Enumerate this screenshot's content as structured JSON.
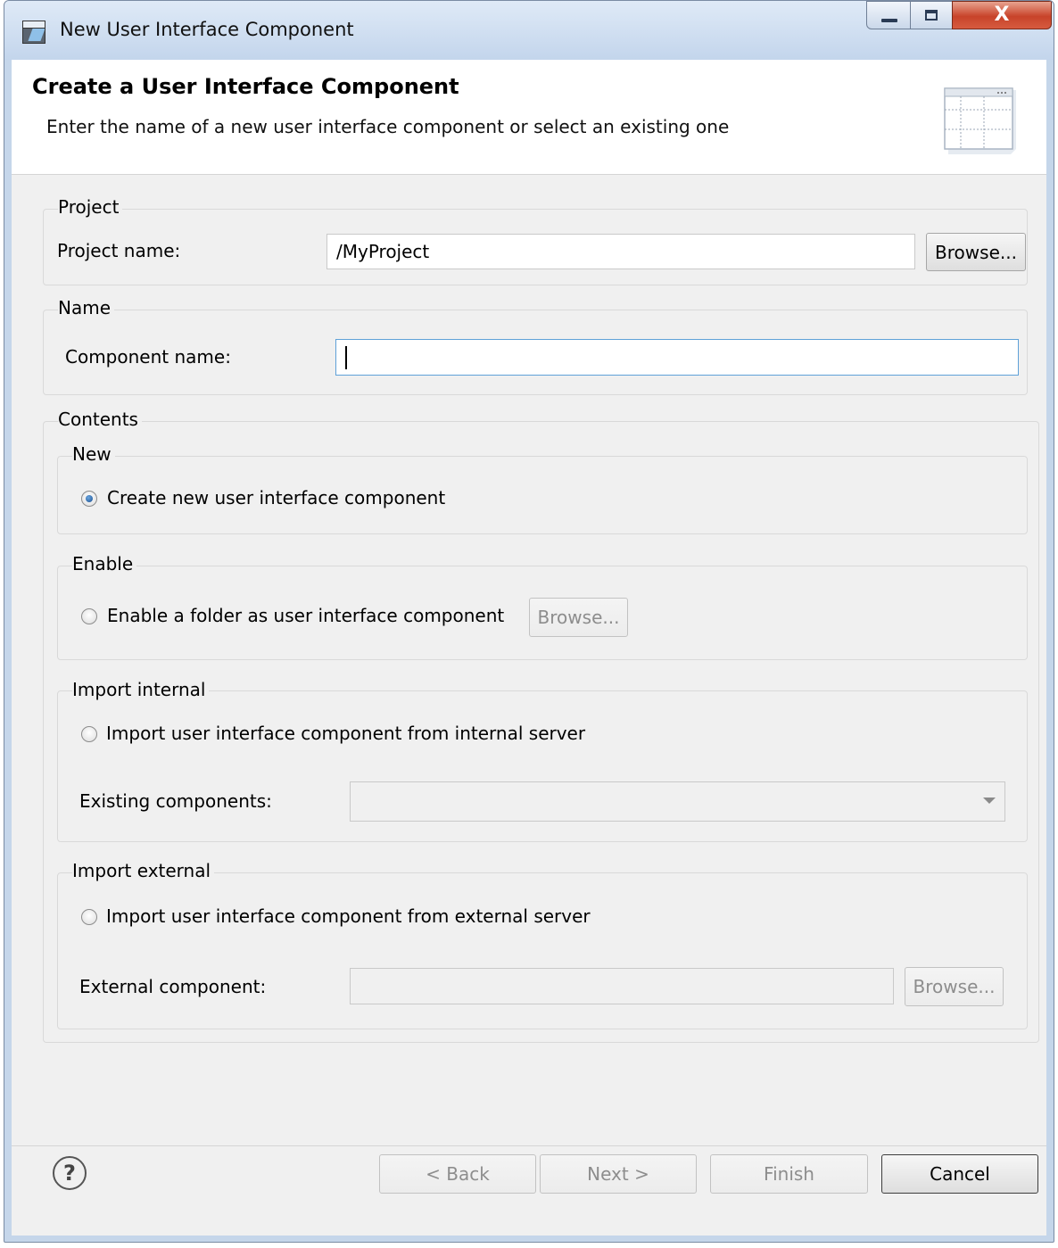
{
  "window": {
    "title": "New User Interface Component",
    "close_glyph": "X"
  },
  "header": {
    "title": "Create a User Interface Component",
    "description": "Enter the name of a new user interface component or select an existing one"
  },
  "project_group": {
    "label": "Project",
    "name_label": "Project name:",
    "name_value": "/MyProject",
    "browse_label": "Browse..."
  },
  "name_group": {
    "label": "Name",
    "component_label": "Component name:",
    "component_value": ""
  },
  "contents": {
    "label": "Contents",
    "new": {
      "label": "New",
      "option_label": "Create new user interface component",
      "selected": true
    },
    "enable": {
      "label": "Enable",
      "option_label": "Enable a folder as user interface component",
      "browse_label": "Browse...",
      "selected": false
    },
    "import_internal": {
      "label": "Import internal",
      "option_label": "Import user interface component from internal server",
      "existing_label": "Existing components:",
      "existing_value": "",
      "selected": false
    },
    "import_external": {
      "label": "Import external",
      "option_label": "Import user interface component from external server",
      "external_label": "External component:",
      "external_value": "",
      "browse_label": "Browse...",
      "selected": false
    }
  },
  "footer": {
    "help_glyph": "?",
    "back_label": "< Back",
    "next_label": "Next >",
    "finish_label": "Finish",
    "cancel_label": "Cancel"
  }
}
